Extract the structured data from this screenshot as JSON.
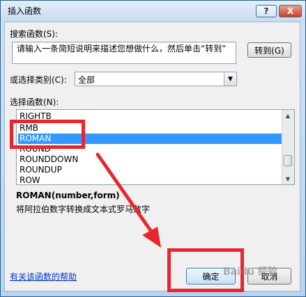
{
  "window": {
    "title": "插入函数"
  },
  "titlebar": {
    "help_glyph": "?",
    "close_glyph": "X"
  },
  "search": {
    "label": "搜索函数(S):",
    "value": "请输入一条简短说明来描述您想做什么，然后单击“转到”",
    "go_button": "转到(G)"
  },
  "category": {
    "label": "或选择类别(C):",
    "selected": "全部"
  },
  "function_list": {
    "label": "选择函数(N):",
    "items": [
      "RIGHTB",
      "RMB",
      "ROMAN",
      "ROUND",
      "ROUNDDOWN",
      "ROUNDUP",
      "ROW"
    ],
    "selected": "ROMAN"
  },
  "description": {
    "signature": "ROMAN(number,form)",
    "text": "将阿拉伯数字转换成文本式罗马数字"
  },
  "footer": {
    "help_link": "有关该函数的帮助",
    "ok": "确定",
    "cancel": "取消"
  },
  "watermark": "Baidu 经验",
  "colors": {
    "selection": "#3399ff",
    "annotation_red": "#e8262c",
    "link": "#0033cc"
  },
  "icons": {
    "dropdown": "chevron-down-icon",
    "scroll_up": "arrow-up-icon",
    "scroll_down": "arrow-down-icon"
  }
}
